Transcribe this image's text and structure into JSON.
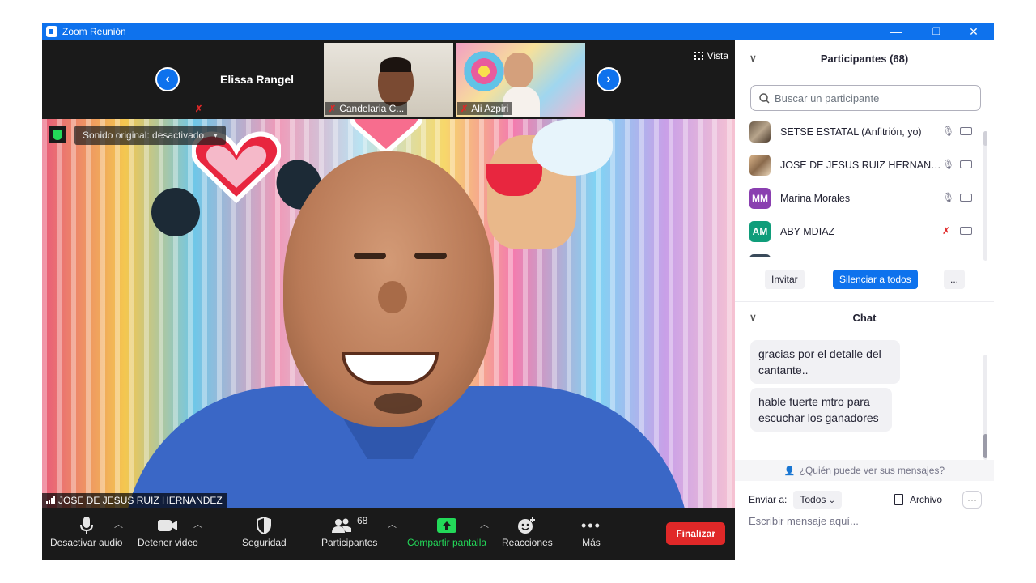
{
  "window": {
    "title": "Zoom Reunión",
    "minimize": "—",
    "restore": "❐",
    "close": "✕"
  },
  "strip": {
    "featured_name": "Elissa Rangel",
    "tiles": [
      {
        "name": "Candelaria C..."
      },
      {
        "name": "Ali Azpiri"
      }
    ],
    "view_label": "Vista"
  },
  "main_video": {
    "sound_label": "Sonido original: desactivado",
    "speaker_name": "JOSE DE JESUS RUIZ HERNANDEZ"
  },
  "toolbar": {
    "items": [
      {
        "label": "Desactivar audio",
        "icon": "microphone-icon"
      },
      {
        "label": "Detener video",
        "icon": "video-camera-icon"
      },
      {
        "label": "Seguridad",
        "icon": "shield-icon"
      },
      {
        "label": "Participantes",
        "icon": "participants-icon",
        "count": "68"
      },
      {
        "label": "Compartir pantalla",
        "icon": "share-screen-icon"
      },
      {
        "label": "Reacciones",
        "icon": "reactions-icon"
      },
      {
        "label": "Más",
        "icon": "more-icon"
      }
    ],
    "end_label": "Finalizar",
    "colors": {
      "share": "#23d959",
      "end": "#e02828"
    }
  },
  "participants": {
    "title": "Participantes (68)",
    "search_placeholder": "Buscar un participante",
    "list": [
      {
        "name": "SETSE ESTATAL (Anfitrión, yo)",
        "avatar": "",
        "mic_muted": false
      },
      {
        "name": "JOSE DE JESUS RUIZ HERNAND...",
        "avatar": "",
        "mic_muted": false
      },
      {
        "name": "Marina Morales",
        "avatar": "MM",
        "avatar_color": "#8a3fb0",
        "mic_muted": false
      },
      {
        "name": "ABY MDIAZ",
        "avatar": "AM",
        "avatar_color": "#0f9d7a",
        "mic_muted": true
      }
    ],
    "invite_label": "Invitar",
    "mute_all_label": "Silenciar a todos",
    "more_label": "..."
  },
  "chat": {
    "title": "Chat",
    "messages": [
      {
        "text": "gracias por el detalle del cantante.."
      },
      {
        "text": "hable fuerte mtro para escuchar los ganadores"
      }
    ],
    "who_can_see": "¿Quién puede ver sus mensajes?",
    "send_to_label": "Enviar a:",
    "recipient": "Todos",
    "file_label": "Archivo",
    "more_label": "···",
    "input_placeholder": "Escribir mensaje aquí..."
  },
  "accent": "#0e72ed"
}
